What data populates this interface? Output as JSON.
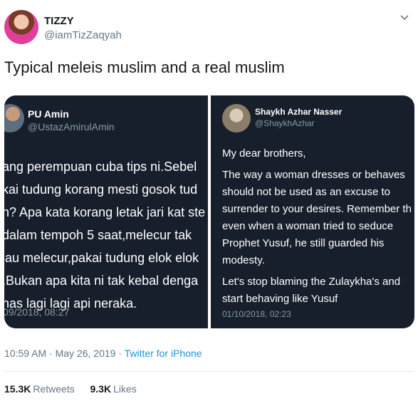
{
  "author": {
    "name": "TIZZY",
    "handle": "@iamTizZaqyah"
  },
  "tweet_text": "Typical meleis muslim and a real muslim",
  "media": {
    "left": {
      "name": "PU Amin",
      "handle": "@UstazAmirulAmin",
      "lines": [
        "ang perempuan cuba tips ni.Sebel",
        "kai tudung korang mesti gosok tud",
        "h? Apa kata korang letak jari kat ste",
        "dalam tempoh 5 saat,melecur tak",
        "lau melecur,pakai tudung elok elok",
        ".Bukan apa kita ni tak kebal denga",
        "nas lagi lagi api neraka."
      ],
      "timestamp": "09/2018, 08:27"
    },
    "right": {
      "name": "Shaykh Azhar Nasser",
      "handle": "@ShaykhAzhar",
      "greeting": "My dear brothers,",
      "paragraph1": "The way a woman dresses or behaves should not be used as an excuse to surrender to your desires. Remember th even when a woman tried to seduce Prophet Yusuf, he still guarded his modesty.",
      "paragraph2": "Let's stop blaming the Zulaykha's and start behaving like Yusuf",
      "timestamp": "01/10/2018, 02:23"
    }
  },
  "meta": {
    "time": "10:59 AM · May 26, 2019 · ",
    "source": "Twitter for iPhone"
  },
  "stats": {
    "retweets_count": "15.3K",
    "retweets_label": "Retweets",
    "likes_count": "9.3K",
    "likes_label": "Likes"
  },
  "icons": {
    "avatar": "profile-photo",
    "menu": "chevron-down-icon"
  }
}
